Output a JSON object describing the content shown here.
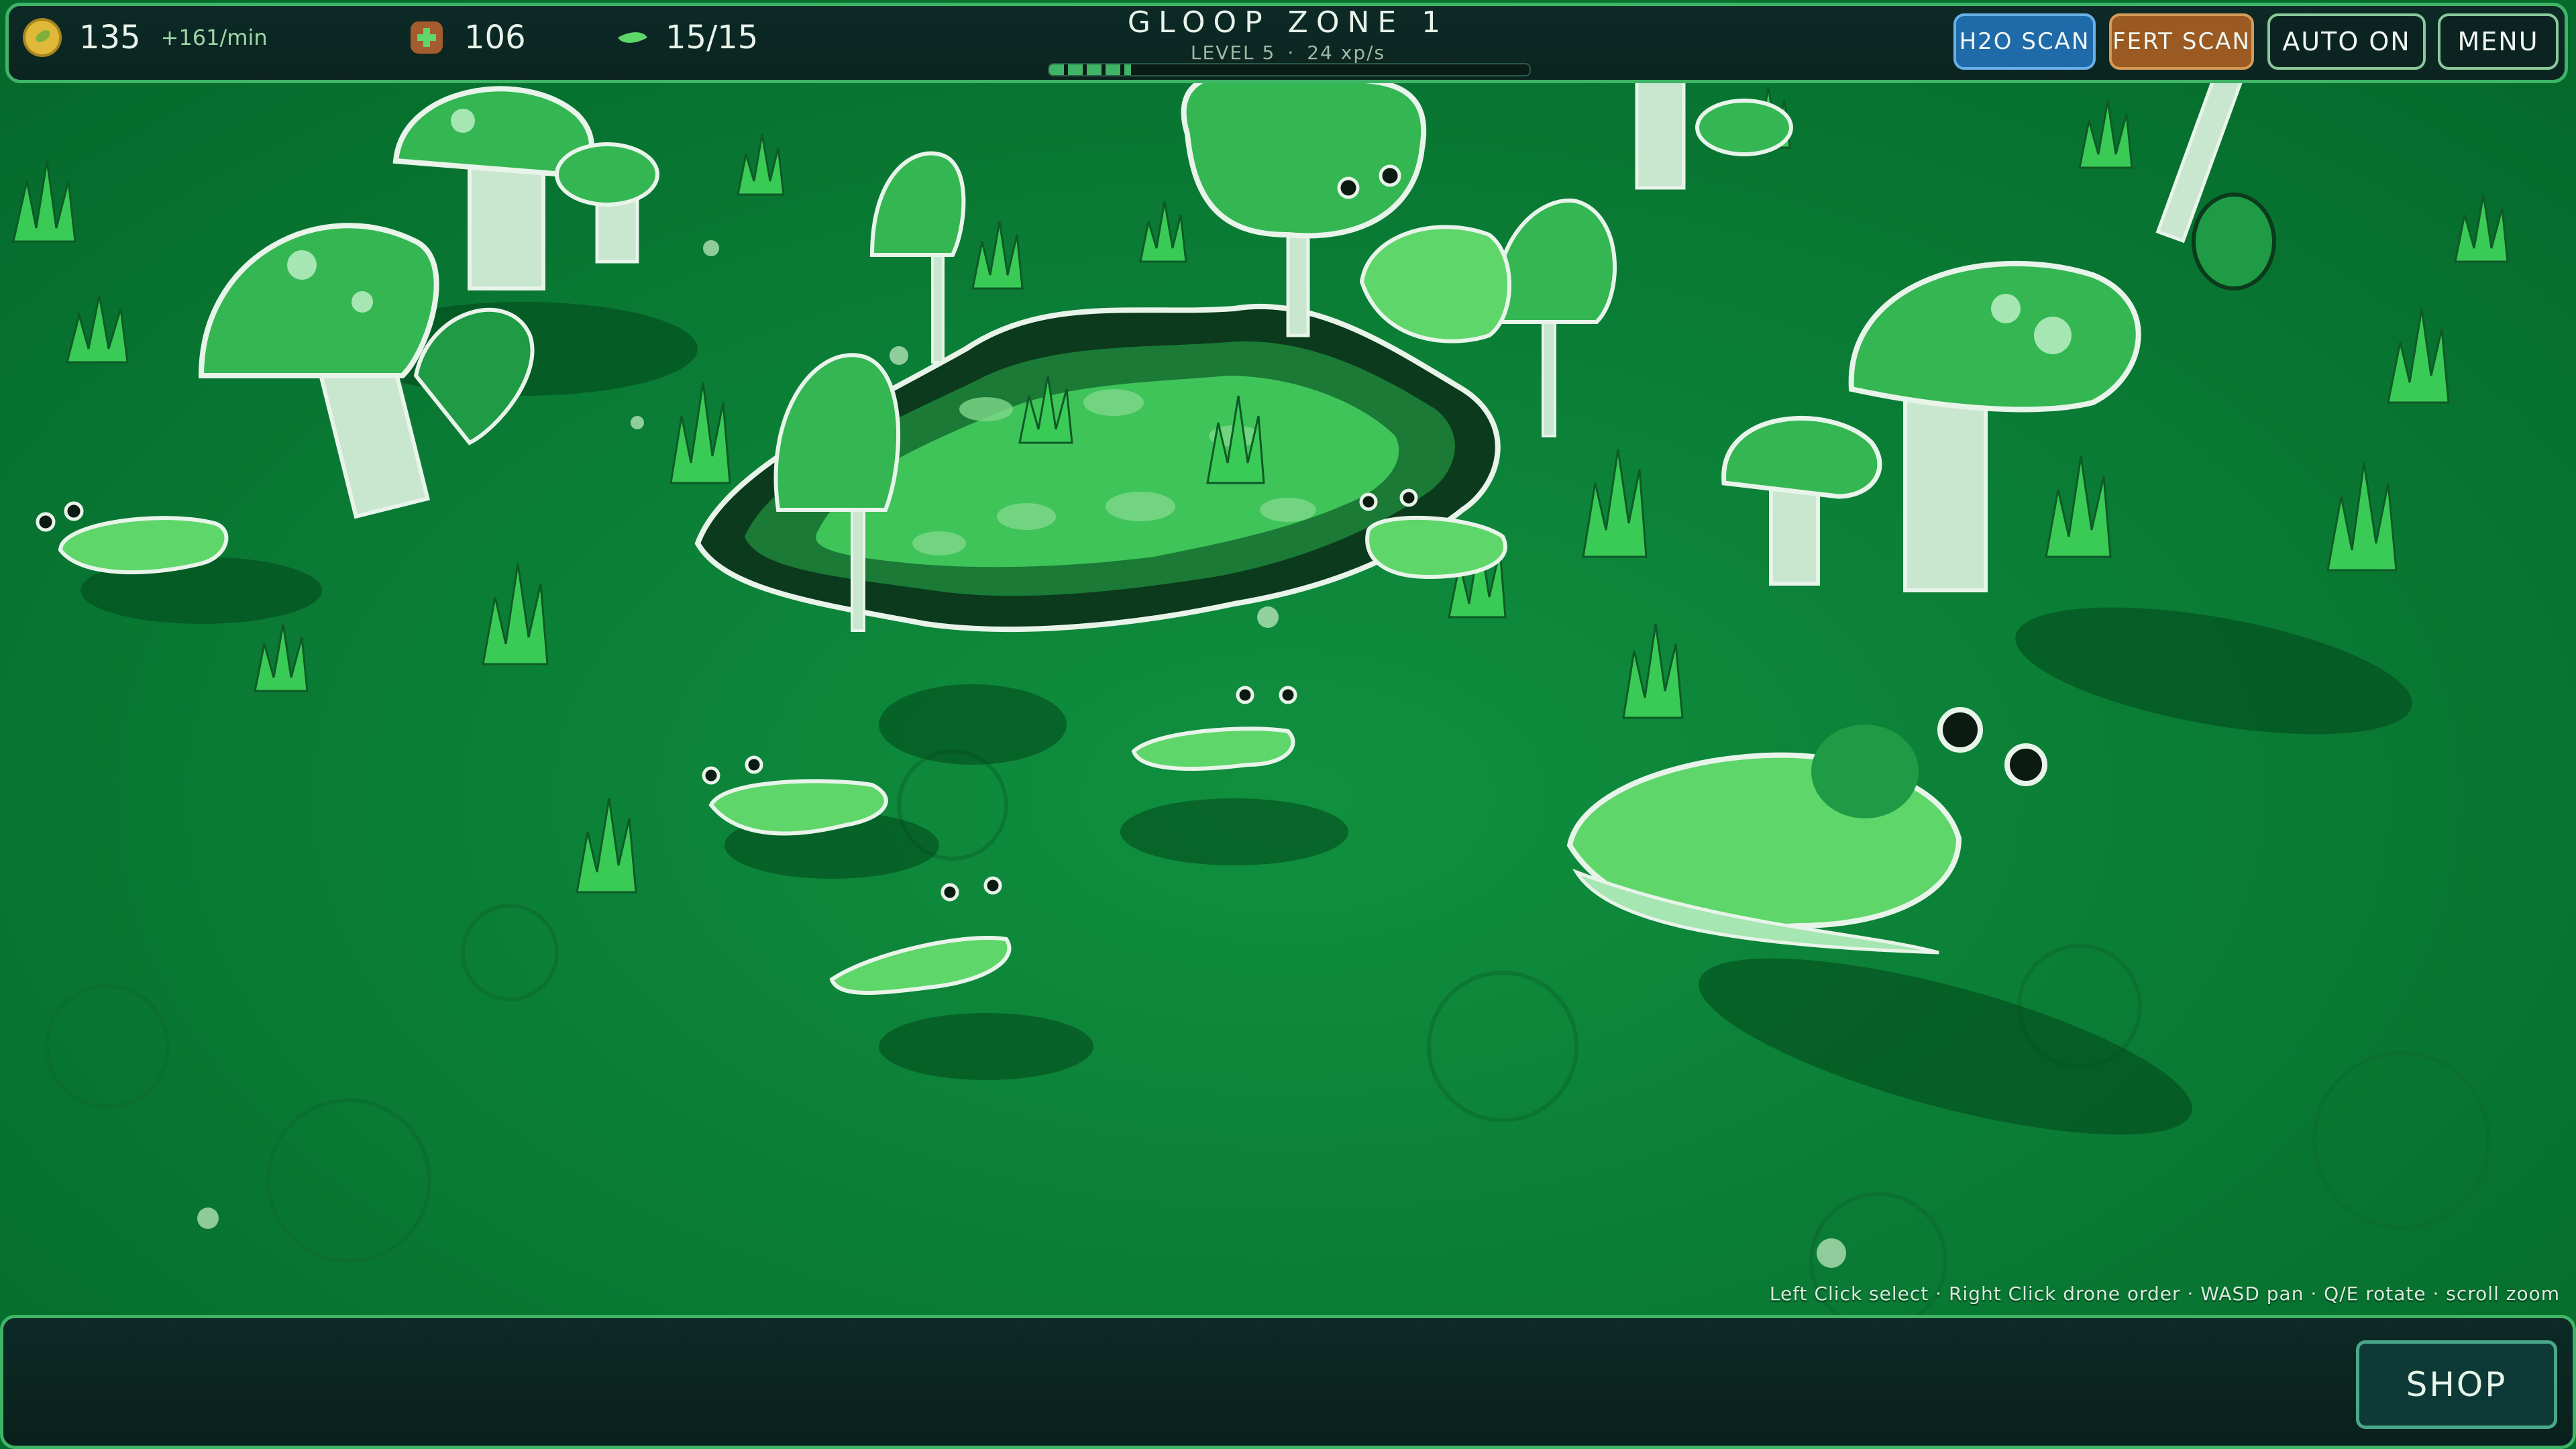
{
  "resources": {
    "gold": "135",
    "gold_rate": "+161/min",
    "health": "106",
    "plants": "15/15"
  },
  "zone": {
    "title": "GLOOP ZONE 1",
    "level": "LEVEL 5",
    "separator": "·",
    "xp_rate": "24 xp/s",
    "xp_progress": 0.17
  },
  "buttons": {
    "h2o_scan": "H2O SCAN",
    "fert_scan": "FERT SCAN",
    "auto": "AUTO ON",
    "menu": "MENU",
    "shop": "SHOP"
  },
  "controls_hint": "Left Click select · Right Click drone order · WASD pan · Q/E rotate · scroll zoom",
  "colors": {
    "ground": "#0a7a35",
    "hud_border": "#3fb466",
    "h2o_button": "#1f6aa8",
    "fert_button": "#9a5a22",
    "creature": "#5fd66a",
    "pond": "#0b5a28"
  },
  "icons": {
    "gold": "coin-icon",
    "health": "medkit-icon",
    "plants": "leaf-icon"
  }
}
